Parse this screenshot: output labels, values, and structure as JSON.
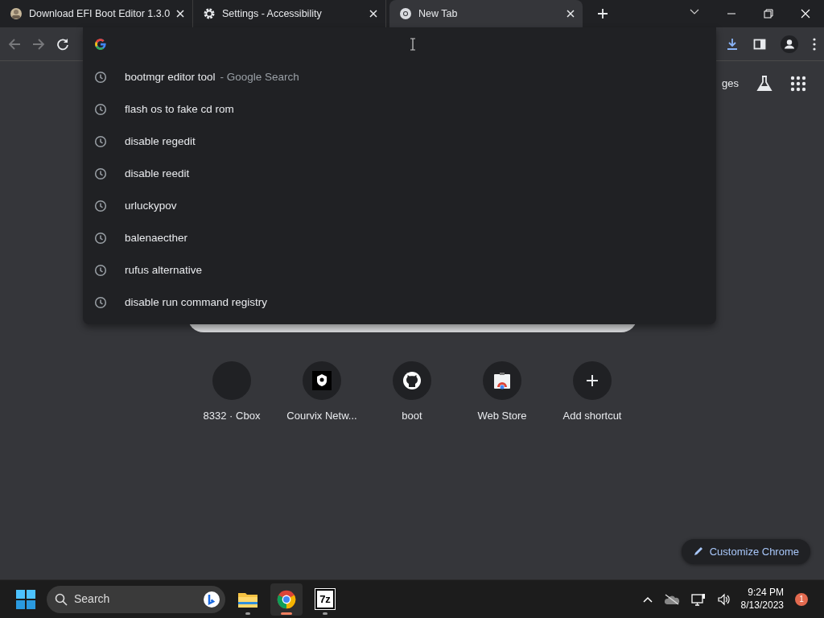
{
  "tabs": [
    {
      "title": "Download EFI Boot Editor 1.3.0",
      "selected": false,
      "kind": "site"
    },
    {
      "title": "Settings - Accessibility",
      "selected": false,
      "kind": "gear"
    },
    {
      "title": "New Tab",
      "selected": true,
      "kind": "chrome"
    }
  ],
  "header_links": [
    "ges"
  ],
  "suggestions": [
    {
      "text": "bootmgr editor tool",
      "hint": "- Google Search"
    },
    {
      "text": "flash os to fake cd rom"
    },
    {
      "text": "disable regedit"
    },
    {
      "text": "disable reedit"
    },
    {
      "text": "urluckypov"
    },
    {
      "text": "balenaecther"
    },
    {
      "text": "rufus alternative"
    },
    {
      "text": "disable run command registry"
    }
  ],
  "shortcuts": [
    {
      "label": "8332 · Cbox",
      "kind": "blank"
    },
    {
      "label": "Courvix Netw...",
      "kind": "shield"
    },
    {
      "label": "boot",
      "kind": "github"
    },
    {
      "label": "Web Store",
      "kind": "store"
    },
    {
      "label": "Add shortcut",
      "kind": "add"
    }
  ],
  "customize_button": "Customize Chrome",
  "taskbar": {
    "search_placeholder": "Search",
    "apps": [
      {
        "kind": "files",
        "selected": false
      },
      {
        "kind": "chrome",
        "selected": true
      },
      {
        "kind": "archiver",
        "label": "7z",
        "selected": false
      }
    ],
    "time": "9:24 PM",
    "date": "8/13/2023",
    "notification_count": "1"
  }
}
